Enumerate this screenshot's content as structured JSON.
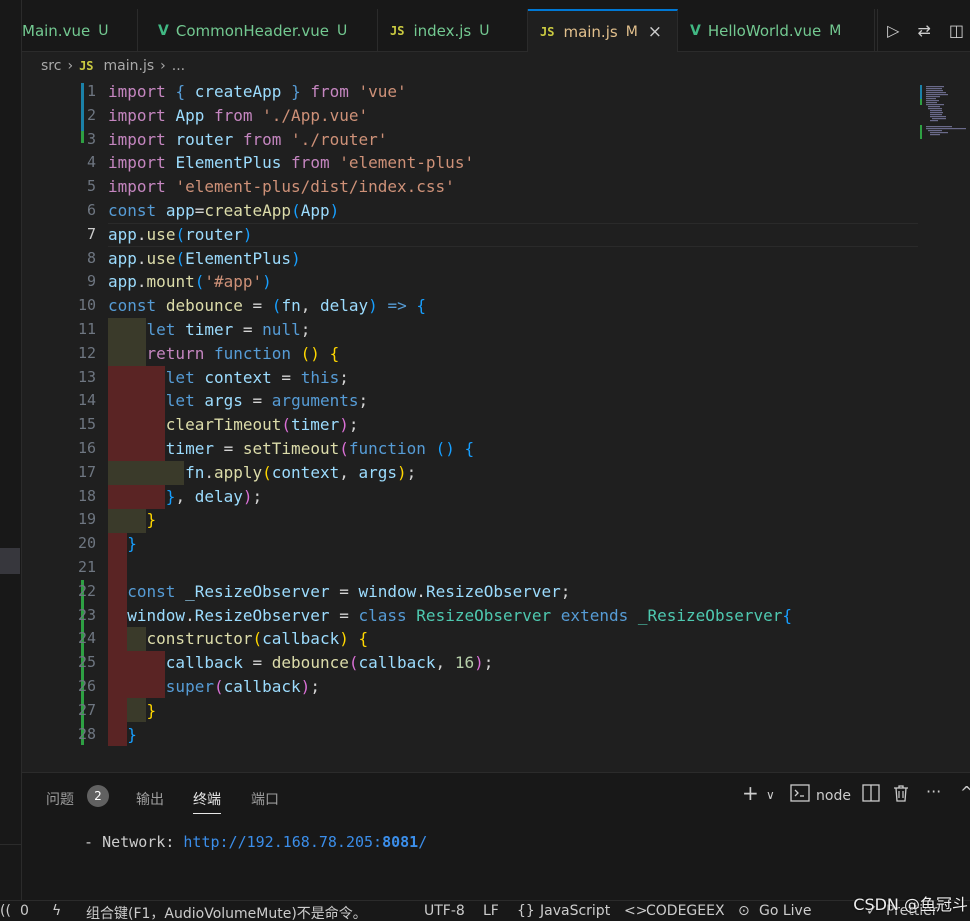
{
  "tabs": [
    {
      "label": "Main.vue",
      "status": "U",
      "icon": "vue-icon"
    },
    {
      "label": "CommonHeader.vue",
      "status": "U",
      "icon": "vue-icon"
    },
    {
      "label": "index.js",
      "status": "U",
      "icon": "js-icon"
    },
    {
      "label": "main.js",
      "status": "M",
      "icon": "js-icon",
      "active": true,
      "close": "×"
    },
    {
      "label": "HelloWorld.vue",
      "status": "M",
      "icon": "vue-icon"
    }
  ],
  "tab_icons": {
    "vue": "V",
    "js": "JS"
  },
  "tab_actions": [
    "▷",
    "⇄",
    "◫"
  ],
  "breadcrumb": {
    "folder": "src",
    "file": "main.js",
    "more": "...",
    "sep": "›"
  },
  "line_numbers": [
    "1",
    "2",
    "3",
    "4",
    "5",
    "6",
    "7",
    "8",
    "9",
    "10",
    "11",
    "12",
    "13",
    "14",
    "15",
    "16",
    "17",
    "18",
    "19",
    "20",
    "21",
    "22",
    "23",
    "24",
    "25",
    "26",
    "27",
    "28"
  ],
  "current_line": 7,
  "panel": {
    "tabs": [
      "问题",
      "输出",
      "终端",
      "端口"
    ],
    "problems_count": "2",
    "node_label": "node",
    "terminal_prefix": "  - Network: ",
    "terminal_url": "http://192.168.78.205:",
    "terminal_port": "8081",
    "terminal_suffix": "/"
  },
  "status": {
    "errors": "0",
    "message": "组合键(F1，AudioVolumeMute)不是命令。",
    "encoding": "UTF-8",
    "eol": "LF",
    "language": "JavaScript",
    "codegeex": "CODEGEEX",
    "golive": "Go Live",
    "prettier": "Prettier"
  },
  "watermark": "CSDN @鱼冠斗"
}
